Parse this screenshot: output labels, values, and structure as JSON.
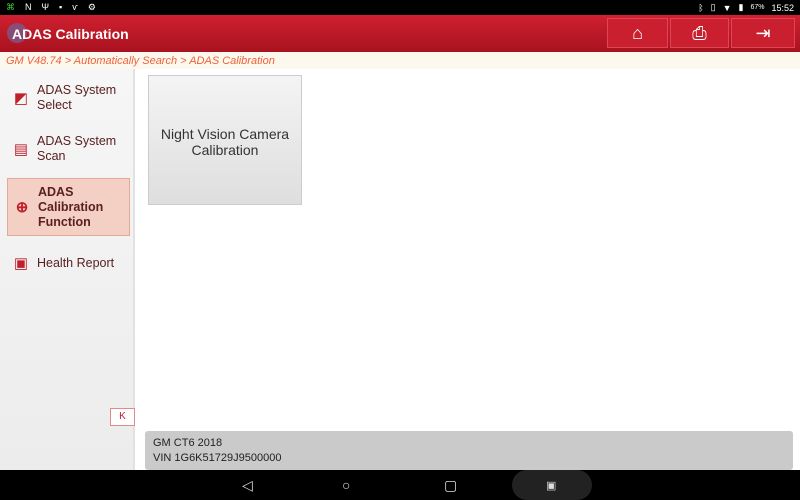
{
  "status_bar": {
    "battery": "67%",
    "time": "15:52"
  },
  "header": {
    "title": "ADAS Calibration",
    "buttons": [
      {
        "icon": "home-icon"
      },
      {
        "icon": "print-icon"
      },
      {
        "icon": "exit-icon"
      }
    ]
  },
  "breadcrumb": "GM V48.74 > Automatically Search > ADAS Calibration",
  "sidebar": {
    "items": [
      {
        "label": "ADAS System Select",
        "icon": "cursor-select-icon"
      },
      {
        "label": "ADAS System Scan",
        "icon": "scan-icon"
      },
      {
        "label": "ADAS Calibration Function",
        "icon": "target-icon",
        "selected": true
      },
      {
        "label": "Health Report",
        "icon": "report-icon"
      }
    ],
    "collapse_label": "K"
  },
  "main": {
    "tiles": [
      {
        "label": "Night Vision Camera Calibration"
      }
    ]
  },
  "vehicle": {
    "model": "GM CT6 2018",
    "vin": "VIN 1G6K51729J9500000"
  },
  "colors": {
    "brand": "#c81e2c",
    "breadcrumb": "#f0603a",
    "selected": "#f3cfc4"
  }
}
